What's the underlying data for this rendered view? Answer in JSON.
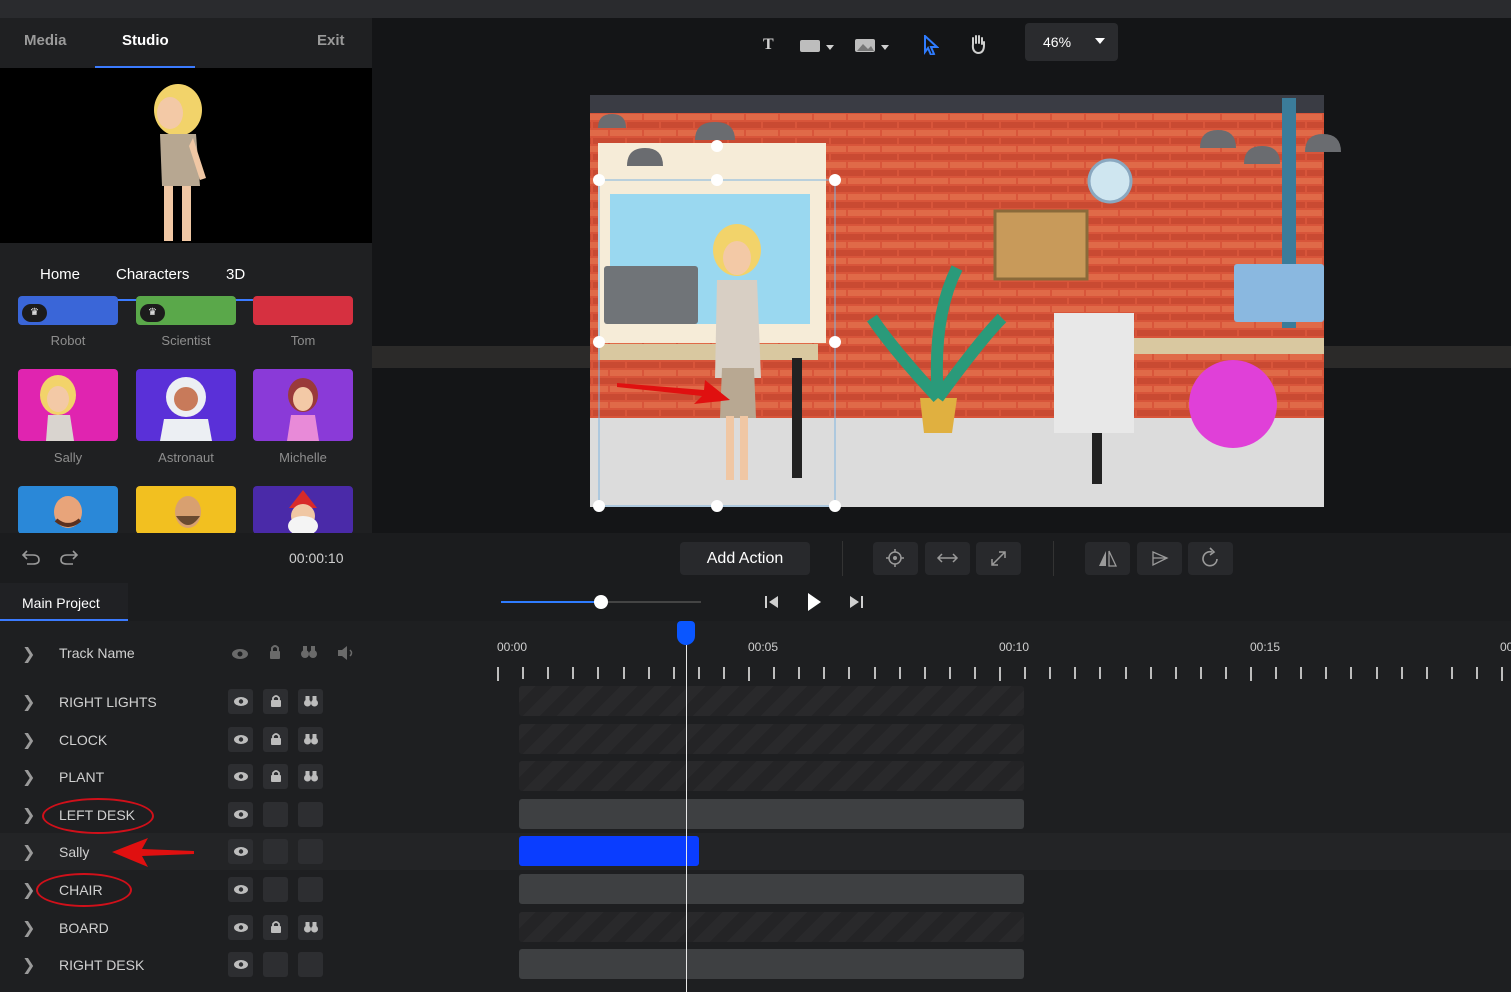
{
  "left_panel": {
    "tabs": {
      "media": "Media",
      "studio": "Studio",
      "exit": "Exit"
    },
    "subtabs": {
      "home": "Home",
      "characters": "Characters",
      "threed": "3D"
    },
    "characters": [
      {
        "name": "Robot",
        "premium": true,
        "color": "#3a66d8"
      },
      {
        "name": "Scientist",
        "premium": true,
        "color": "#5aa84a"
      },
      {
        "name": "Tom",
        "premium": false,
        "color": "#d63040"
      },
      {
        "name": "Sally",
        "premium": false,
        "color": "#e024b0"
      },
      {
        "name": "Astronaut",
        "premium": false,
        "color": "#5a30d8"
      },
      {
        "name": "Michelle",
        "premium": false,
        "color": "#8a3ad8"
      },
      {
        "name": "",
        "premium": false,
        "color": "#2a88d8"
      },
      {
        "name": "",
        "premium": false,
        "color": "#f2c020"
      },
      {
        "name": "",
        "premium": false,
        "color": "#4a2aa8"
      }
    ]
  },
  "toolbar": {
    "text_tool": "T",
    "zoom": "46%"
  },
  "actions": {
    "time": "00:00:10",
    "add_action": "Add Action"
  },
  "project": {
    "tab": "Main Project",
    "scrub_level": 0.5
  },
  "timeline": {
    "header": "Track Name",
    "time_labels": [
      "00:00",
      "00:05",
      "00:10",
      "00:15",
      "00"
    ],
    "playhead_seconds": 3.4,
    "tracks": [
      {
        "name": "RIGHT LIGHTS",
        "locked": true,
        "clip": "dim",
        "circled": false
      },
      {
        "name": "CLOCK",
        "locked": true,
        "clip": "dim",
        "circled": false
      },
      {
        "name": "PLANT",
        "locked": true,
        "clip": "dim",
        "circled": false
      },
      {
        "name": "LEFT DESK",
        "locked": false,
        "clip": "solid",
        "circled": true
      },
      {
        "name": "Sally",
        "locked": false,
        "clip": "selected",
        "circled": false,
        "arrow": true
      },
      {
        "name": "CHAIR",
        "locked": false,
        "clip": "solid",
        "circled": true
      },
      {
        "name": "BOARD",
        "locked": true,
        "clip": "dim",
        "circled": false
      },
      {
        "name": "RIGHT DESK",
        "locked": false,
        "clip": "solid",
        "circled": false
      }
    ]
  },
  "colors": {
    "accent": "#3b7bff",
    "selected_clip": "#0a3dff",
    "annotation": "#d0101a"
  }
}
